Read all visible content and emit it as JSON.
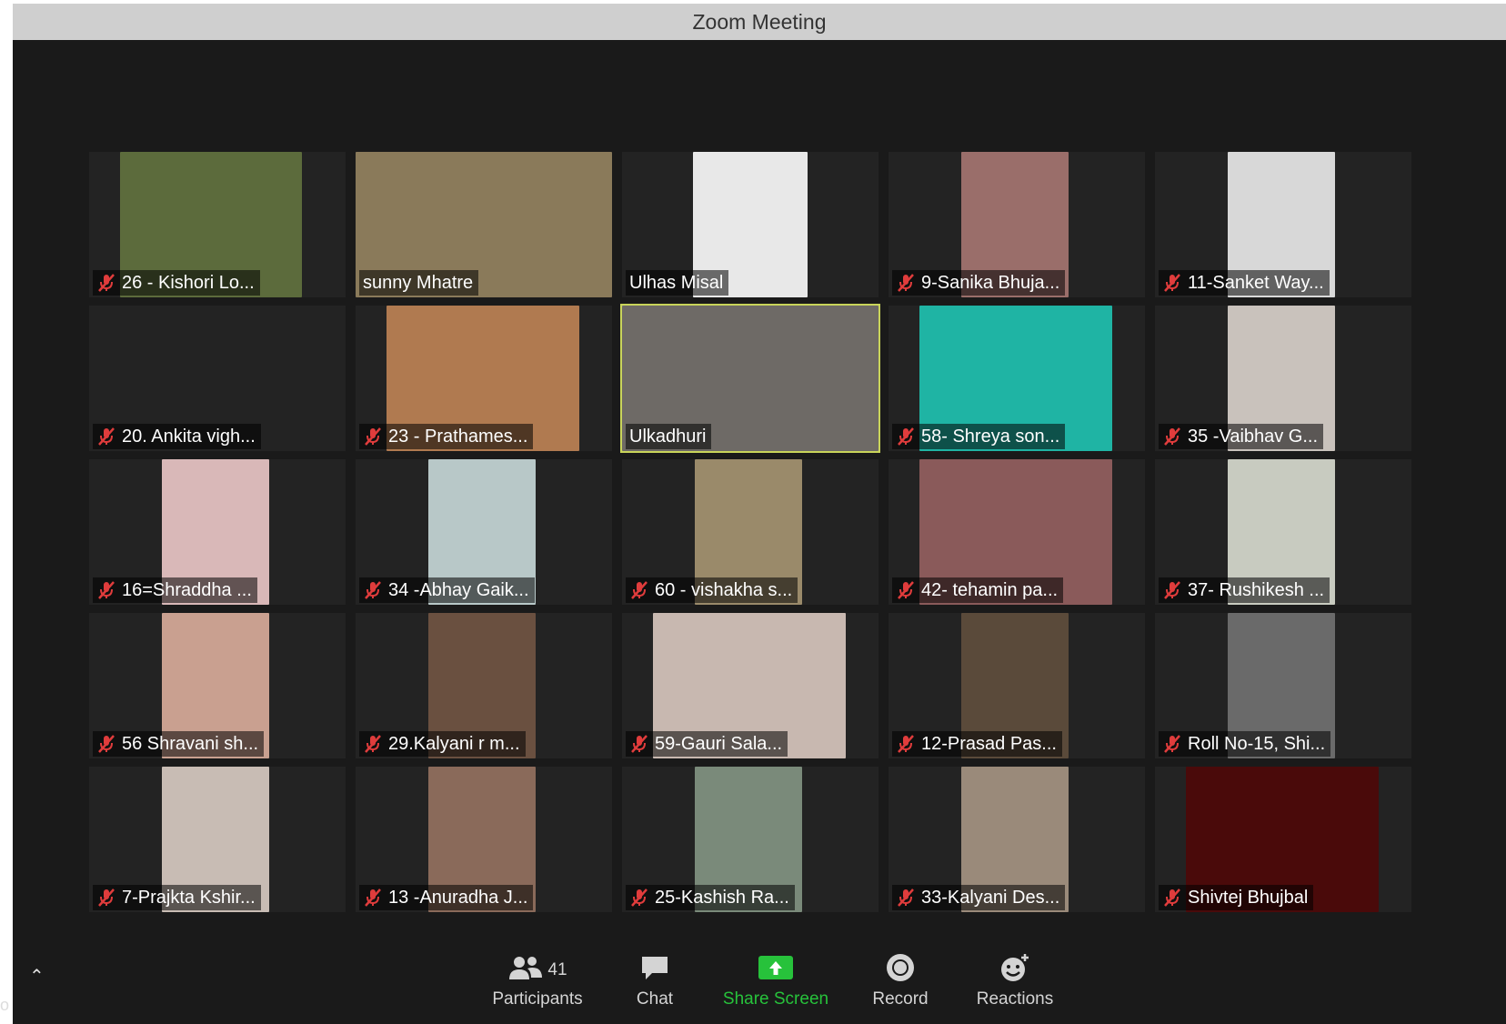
{
  "window": {
    "title": "Zoom Meeting"
  },
  "left_edge_char": "o",
  "colors": {
    "active_speaker_border": "#c9d45a",
    "share_green": "#27c23b",
    "mute_red": "#e03c3c",
    "background": "#1a1a1a"
  },
  "participants": [
    {
      "name": "26 - Kishori Lo...",
      "muted": true,
      "video_color": "#5c6b3c"
    },
    {
      "name": "sunny Mhatre",
      "muted": false,
      "video_color": "#8a7a5a"
    },
    {
      "name": "Ulhas Misal",
      "muted": false,
      "video_color": "#e8e8e8"
    },
    {
      "name": "9-Sanika Bhuja...",
      "muted": true,
      "video_color": "#9a6e6a"
    },
    {
      "name": "11-Sanket Way...",
      "muted": true,
      "video_color": "#d8d8d8"
    },
    {
      "name": "20. Ankita vigh...",
      "muted": true,
      "video_color": ""
    },
    {
      "name": "23 - Prathames...",
      "muted": true,
      "video_color": "#b07a50"
    },
    {
      "name": "Ulkadhuri",
      "muted": false,
      "video_color": "#6e6a66"
    },
    {
      "name": "58- Shreya son...",
      "muted": true,
      "video_color": "#1fb4a4"
    },
    {
      "name": "35 -Vaibhav G...",
      "muted": true,
      "video_color": "#c9c2bc"
    },
    {
      "name": "16=Shraddha ...",
      "muted": true,
      "video_color": "#d9b8b8"
    },
    {
      "name": "34 -Abhay Gaik...",
      "muted": true,
      "video_color": "#b8c8c8"
    },
    {
      "name": "60 - vishakha s...",
      "muted": true,
      "video_color": "#9a8a6a"
    },
    {
      "name": "42- tehamin pa...",
      "muted": true,
      "video_color": "#8a5a5a"
    },
    {
      "name": "37- Rushikesh ...",
      "muted": true,
      "video_color": "#c8cbc0"
    },
    {
      "name": "56 Shravani sh...",
      "muted": true,
      "video_color": "#c9a090"
    },
    {
      "name": "29.Kalyani r m...",
      "muted": true,
      "video_color": "#6a5040"
    },
    {
      "name": "59-Gauri Sala...",
      "muted": true,
      "video_color": "#c8b8b0"
    },
    {
      "name": "12-Prasad Pas...",
      "muted": true,
      "video_color": "#5a4a3a"
    },
    {
      "name": "Roll No-15, Shi...",
      "muted": true,
      "video_color": "#6a6a6a"
    },
    {
      "name": "7-Prajkta Kshir...",
      "muted": true,
      "video_color": "#c8bcb4"
    },
    {
      "name": "13 -Anuradha J...",
      "muted": true,
      "video_color": "#8a6a5a"
    },
    {
      "name": "25-Kashish Ra...",
      "muted": true,
      "video_color": "#7a8a7a"
    },
    {
      "name": "33-Kalyani Des...",
      "muted": true,
      "video_color": "#9a8a7a"
    },
    {
      "name": "Shivtej Bhujbal",
      "muted": true,
      "video_color": "#4a0a0a"
    }
  ],
  "toolbar": {
    "participants": {
      "label": "Participants",
      "count": "41",
      "icon": "participants-icon"
    },
    "chat": {
      "label": "Chat",
      "icon": "chat-icon"
    },
    "share_screen": {
      "label": "Share Screen",
      "icon": "share-screen-icon"
    },
    "record": {
      "label": "Record",
      "icon": "record-icon"
    },
    "reactions": {
      "label": "Reactions",
      "icon": "reactions-icon"
    }
  }
}
